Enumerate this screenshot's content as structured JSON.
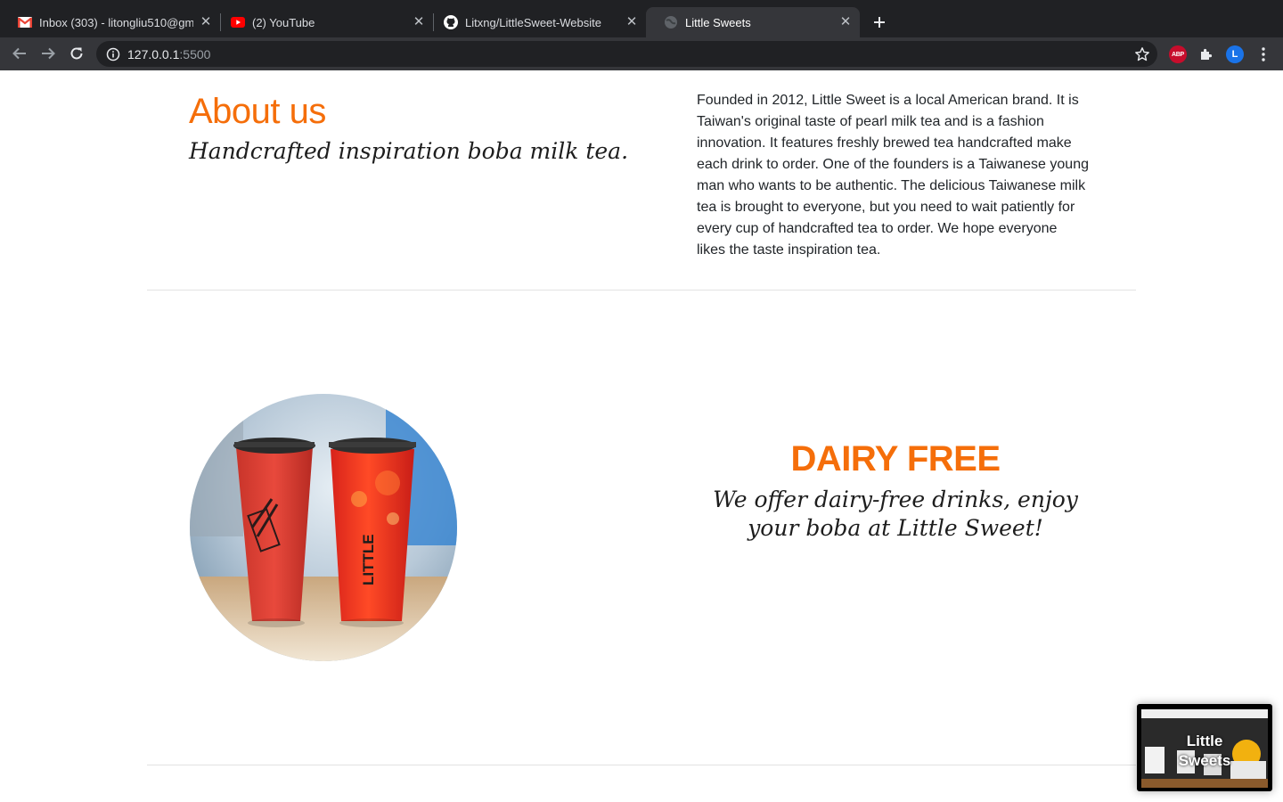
{
  "browser": {
    "tabs": [
      {
        "title": "Inbox (303) - litongliu510@gm",
        "icon": "gmail-icon",
        "active": false
      },
      {
        "title": "(2) YouTube",
        "icon": "youtube-icon",
        "active": false
      },
      {
        "title": "Litxng/LittleSweet-Website",
        "icon": "github-icon",
        "active": false
      },
      {
        "title": "Little Sweets",
        "icon": "globe-icon",
        "active": true
      }
    ],
    "url_host": "127.0.0.1",
    "url_port": ":5500",
    "extensions": {
      "adblock_label": "ABP",
      "profile_initial": "L"
    }
  },
  "about": {
    "title": "About us",
    "subtitle": "Handcrafted inspiration boba milk tea.",
    "body": "Founded in 2012, Little Sweet is a local American brand. It is Taiwan's original taste of pearl milk tea and is a fashion innovation. It features freshly brewed tea handcrafted make each drink to order. One of the founders is a Taiwanese young man who wants to be authentic. The delicious Taiwanese milk tea is brought to everyone, but you need to wait patiently for every cup of handcrafted tea to order. We hope everyone likes the taste inspiration tea."
  },
  "dairy_free": {
    "title": "DAIRY FREE",
    "subtitle": "We offer dairy-free drinks, enjoy your boba at Little Sweet!",
    "image_text": "LITTLE"
  },
  "pip_preview": {
    "line1": "Little",
    "line2": "Sweets"
  },
  "colors": {
    "accent": "#f56e0a",
    "chrome_dark": "#202124",
    "chrome_mid": "#35363a"
  }
}
